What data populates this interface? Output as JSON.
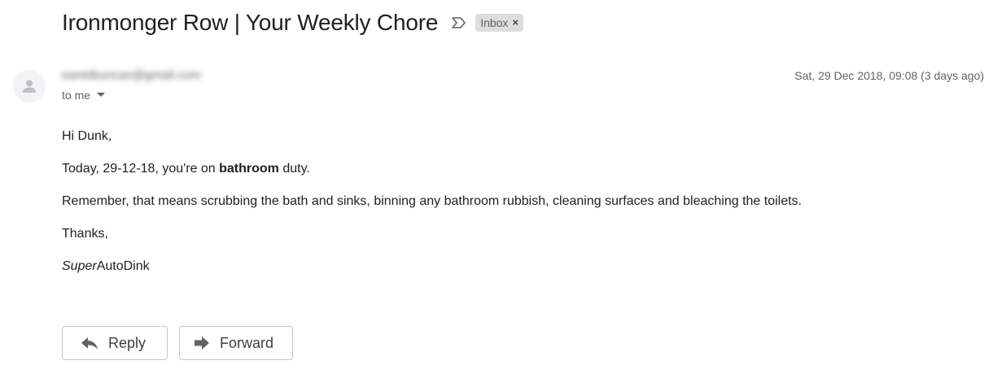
{
  "subject": "Ironmonger Row | Your Weekly Chore",
  "label": {
    "name": "Inbox",
    "remove_glyph": "×"
  },
  "sender": {
    "email": "eanetbuncan@gmail.com"
  },
  "recipient_text": "to me",
  "date": "Sat, 29 Dec 2018, 09:08 (3 days ago)",
  "body": {
    "greeting": "Hi Dunk,",
    "duty_before": "Today, 29-12-18, you're on ",
    "duty_bold": "bathroom",
    "duty_after": " duty.",
    "reminder": "Remember, that means scrubbing the bath and sinks, binning any bathroom rubbish, cleaning surfaces and bleaching the toilets.",
    "thanks": "Thanks,",
    "signature_italic": "Super",
    "signature_rest": "AutoDink"
  },
  "actions": {
    "reply": "Reply",
    "forward": "Forward"
  },
  "icons": [
    "importance-marker-icon",
    "person-icon",
    "dropdown-arrow-icon",
    "reply-icon",
    "forward-icon"
  ],
  "colors": {
    "text": "#202124",
    "muted": "#5f6368",
    "chip_bg": "#dddddd",
    "border": "#c4c7c5"
  }
}
